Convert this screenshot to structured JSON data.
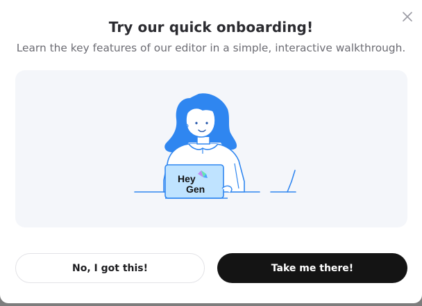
{
  "dialog": {
    "title": "Try our quick onboarding!",
    "subtitle": "Learn the key features of our editor in a simple, interactive walkthrough.",
    "close_icon": "close-icon"
  },
  "illustration": {
    "logo_line1": "Hey",
    "logo_line2": "Gen",
    "accent_color": "#2f86f0",
    "laptop_color": "#bfe3ff"
  },
  "actions": {
    "decline_label": "No, I got this!",
    "accept_label": "Take me there!"
  },
  "colors": {
    "primary_button": "#141414",
    "panel_background": "#f4f6fa"
  }
}
